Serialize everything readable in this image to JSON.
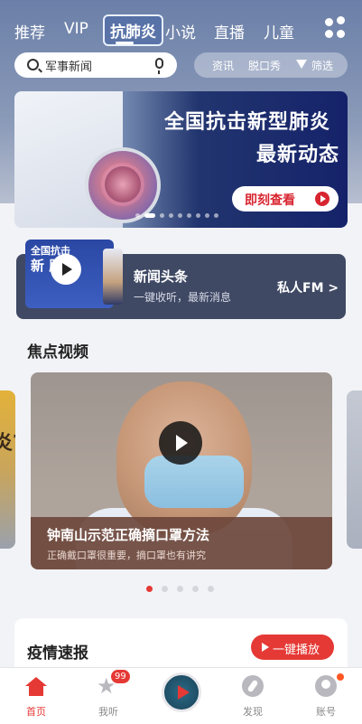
{
  "tabs": [
    {
      "label": "推荐"
    },
    {
      "label": "VIP"
    },
    {
      "label": "抗肺炎"
    },
    {
      "label": "小说"
    },
    {
      "label": "直播"
    },
    {
      "label": "儿童"
    }
  ],
  "search": {
    "placeholder": "军事新闻"
  },
  "quick_links": [
    "资讯",
    "脱口秀",
    "筛选"
  ],
  "banner": {
    "title_line1": "全国抗击新型肺炎",
    "title_line2": "最新动态",
    "button_label": "即刻查看"
  },
  "fm_card": {
    "thumb_line1": "全国抗击",
    "thumb_line2": "新 肺炎",
    "title": "新闻头条",
    "subtitle": "一键收听，最新消息",
    "link_label": "私人FM >"
  },
  "focus_video": {
    "section_title": "焦点视频",
    "left_peek_text": "炎?",
    "title": "钟南山示范正确摘口罩方法",
    "subtitle": "正确戴口罩很重要，摘口罩也有讲究"
  },
  "epidemic": {
    "title": "疫情速报",
    "button_label": "一键播放"
  },
  "bottom_nav": [
    {
      "label": "首页"
    },
    {
      "label": "我听",
      "badge": "99"
    },
    {
      "label": ""
    },
    {
      "label": "发现"
    },
    {
      "label": "账号"
    }
  ],
  "colors": {
    "accent": "#e53935",
    "header": "#6b7fa8",
    "fm_card": "#3f4964"
  }
}
